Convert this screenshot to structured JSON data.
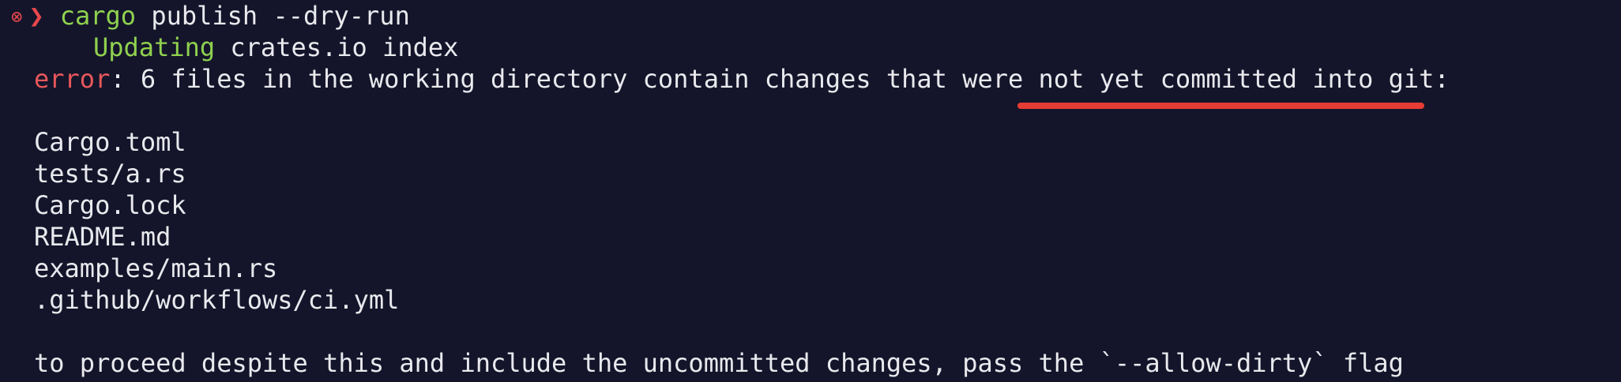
{
  "terminal": {
    "prompt": {
      "status_icon": "⊗",
      "arrow": "❯",
      "command": "cargo",
      "args": " publish --dry-run"
    },
    "updating": {
      "label": "Updating",
      "text": " crates.io index"
    },
    "error": {
      "label": "error",
      "message": ": 6 files in the working directory contain changes that were not yet committed into git:"
    },
    "files": [
      "Cargo.toml",
      "tests/a.rs",
      "Cargo.lock",
      "README.md",
      "examples/main.rs",
      ".github/workflows/ci.yml"
    ],
    "hint": "to proceed despite this and include the uncommitted changes, pass the `--allow-dirty` flag"
  },
  "colors": {
    "background": "#14152a",
    "text": "#e9e9ee",
    "green": "#8fd14f",
    "error_red": "#e8575a",
    "annotation_red": "#e73c34"
  }
}
